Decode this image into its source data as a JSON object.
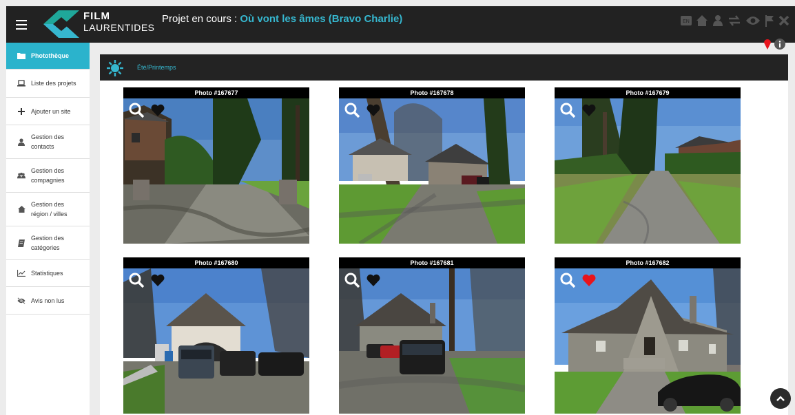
{
  "header": {
    "brand_line1": "FILM",
    "brand_line2": "LAURENTIDES",
    "project_prefix": "Projet en cours : ",
    "project_name": "Où vont les âmes (Bravo Charlie)",
    "lang_label": "EN",
    "icons": [
      "menu-icon",
      "language-icon",
      "home-icon",
      "user-icon",
      "swap-icon",
      "eye-icon",
      "flag-icon",
      "close-icon"
    ]
  },
  "sidebar": {
    "items": [
      {
        "label": "Photothèque",
        "icon": "folder-icon",
        "active": true
      },
      {
        "label": "Liste des projets",
        "icon": "laptop-icon"
      },
      {
        "label": "Ajouter un site",
        "icon": "plus-icon"
      },
      {
        "label": "Gestion des\ncontacts",
        "icon": "user-icon"
      },
      {
        "label": "Gestion des\ncompagnies",
        "icon": "users-icon"
      },
      {
        "label": "Gestion des\nrégion / villes",
        "icon": "home-icon"
      },
      {
        "label": "Gestion des\ncatégories",
        "icon": "book-icon"
      },
      {
        "label": "Statistiques",
        "icon": "chart-icon"
      },
      {
        "label": "Avis non lus",
        "icon": "eye-slash-icon"
      }
    ]
  },
  "season": {
    "label": "Été/Printemps",
    "icon": "sun-icon"
  },
  "photos": [
    {
      "title": "Photo #167677",
      "favorite": false
    },
    {
      "title": "Photo #167678",
      "favorite": false
    },
    {
      "title": "Photo #167679",
      "favorite": false
    },
    {
      "title": "Photo #167680",
      "favorite": false
    },
    {
      "title": "Photo #167681",
      "favorite": false
    },
    {
      "title": "Photo #167682",
      "favorite": true
    }
  ],
  "colors": {
    "accent": "#2bb3cc",
    "topbar": "#222222",
    "favorite_red": "#e8141c"
  }
}
